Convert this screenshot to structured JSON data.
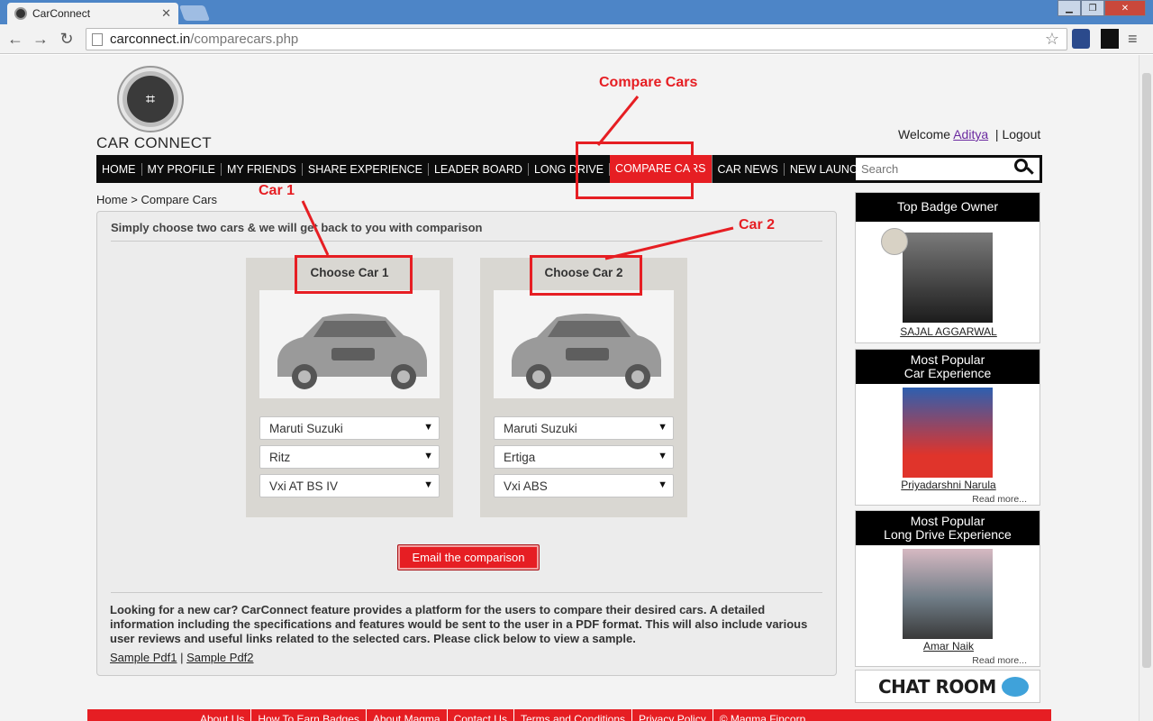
{
  "browser": {
    "tab_title": "CarConnect",
    "url_host": "carconnect.in",
    "url_path": "/comparecars.php"
  },
  "site": {
    "logo_text": "CAR CONNECT",
    "welcome_prefix": "Welcome",
    "username": "Aditya",
    "logout": "Logout",
    "search_placeholder": "Search",
    "nav": [
      "HOME",
      "MY PROFILE",
      "MY FRIENDS",
      "SHARE EXPERIENCE",
      "LEADER BOARD",
      "LONG DRIVE",
      "COMPARE CARS",
      "CAR NEWS",
      "NEW LAUNCHES"
    ],
    "active_nav": "COMPARE CARS",
    "breadcrumb": "Home > Compare Cars"
  },
  "annotations": {
    "compare_cars": "Compare Cars",
    "car1": "Car 1",
    "car2": "Car 2"
  },
  "compare": {
    "heading": "Simply choose two cars & we will get back to you with comparison",
    "car1": {
      "title": "Choose Car 1",
      "make": "Maruti Suzuki",
      "model": "Ritz",
      "variant": "Vxi AT BS IV"
    },
    "car2": {
      "title": "Choose Car 2",
      "make": "Maruti Suzuki",
      "model": "Ertiga",
      "variant": "Vxi ABS"
    },
    "email_button": "Email the comparison",
    "description": "Looking for a new car? CarConnect feature provides a platform for the users to compare their desired cars. A detailed information including the specifications and features would be sent to the user in a PDF format. This will also include various user reviews and useful links related to the selected cars. Please click below to view a sample.",
    "sample1": "Sample Pdf1",
    "sample_sep": "|",
    "sample2": "Sample Pdf2"
  },
  "sidebar": {
    "badge_title": "Top Badge Owner",
    "badge_name": "SAJAL AGGARWAL",
    "car_exp_title_1": "Most Popular",
    "car_exp_title_2": "Car Experience",
    "car_exp_name": "Priyadarshni Narula",
    "drive_title_1": "Most Popular",
    "drive_title_2": "Long Drive Experience",
    "drive_name": "Amar Naik",
    "read_more": "Read more...",
    "chat_room": "CHAT ROOM"
  },
  "footer": [
    "About Us",
    "How To Earn Badges",
    "About Magma",
    "Contact Us",
    "Terms and Conditions",
    "Privacy Policy",
    "© Magma Fincorp"
  ],
  "colors": {
    "accent": "#e61e23",
    "nav_bg": "#0c0c0c",
    "link_visited": "#6b2aa0"
  }
}
